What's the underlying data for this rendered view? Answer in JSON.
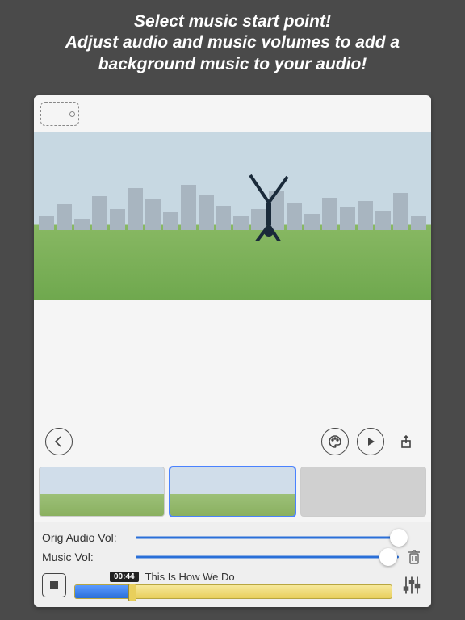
{
  "promo": {
    "line1": "Select music start point!",
    "line2": "Adjust audio and music volumes to add a background music to your audio!"
  },
  "controls": {
    "orig_audio_label": "Orig Audio Vol:",
    "music_vol_label": "Music Vol:",
    "orig_audio_value": 100,
    "music_vol_value": 96
  },
  "track": {
    "time_badge": "00:44",
    "title": "This Is How We Do",
    "progress_percent": 18
  },
  "icons": {
    "device": "device-orientation-icon",
    "back": "chevron-left-icon",
    "palette": "palette-icon",
    "play": "play-icon",
    "share": "share-icon",
    "trash": "trash-icon",
    "stop": "stop-icon",
    "mixer": "mixer-icon"
  }
}
